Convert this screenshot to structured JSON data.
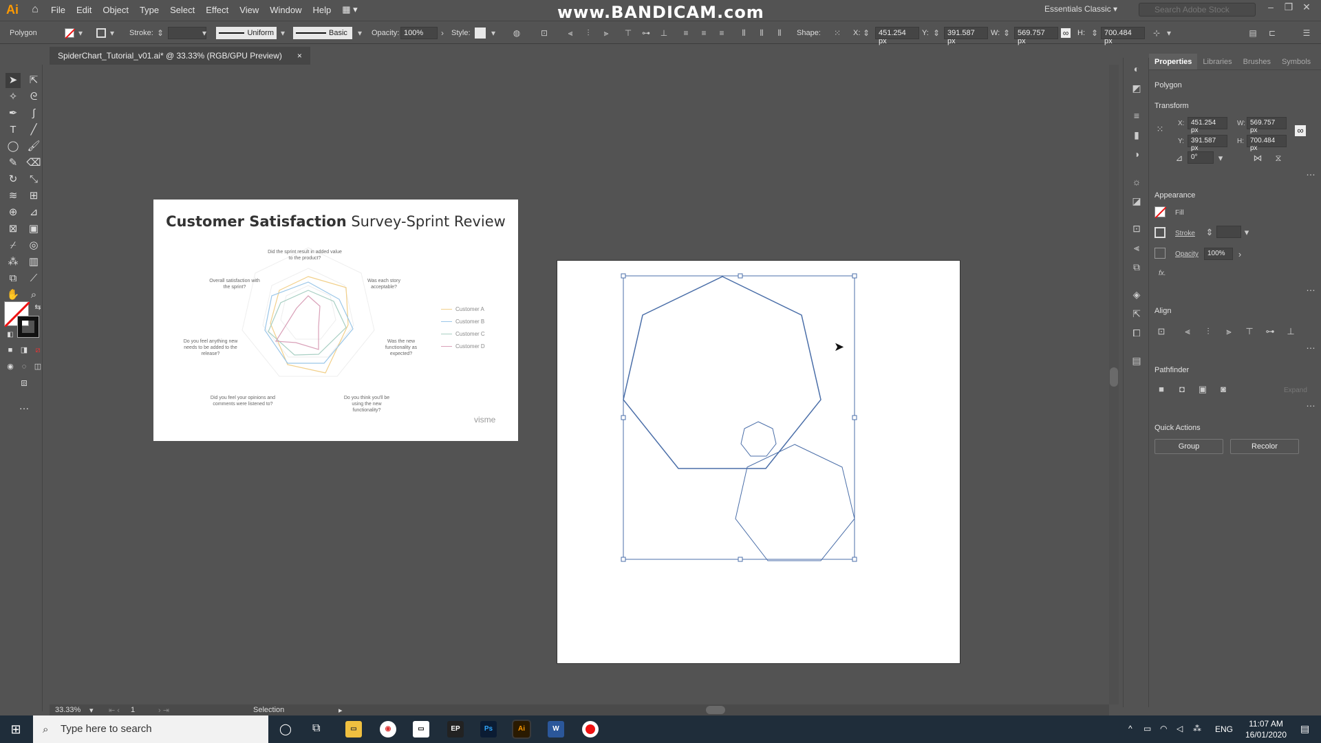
{
  "app": {
    "logo": "Ai",
    "menus": [
      "File",
      "Edit",
      "Object",
      "Type",
      "Select",
      "Effect",
      "View",
      "Window",
      "Help"
    ],
    "watermark": "www.BANDICAM.com",
    "workspace": "Essentials Classic",
    "stock_search_placeholder": "Search Adobe Stock"
  },
  "controlbar": {
    "selection": "Polygon",
    "stroke_label": "Stroke:",
    "stroke_profile": "Uniform",
    "brush": "Basic",
    "opacity_label": "Opacity:",
    "opacity_value": "100%",
    "style_label": "Style:",
    "shape_label": "Shape:",
    "x_label": "X:",
    "x_value": "451.254 px",
    "y_label": "Y:",
    "y_value": "391.587 px",
    "w_label": "W:",
    "w_value": "569.757 px",
    "h_label": "H:",
    "h_value": "700.484 px"
  },
  "document": {
    "tab_title": "SpiderChart_Tutorial_v01.ai* @ 33.33% (RGB/GPU Preview)",
    "close": "×"
  },
  "reference": {
    "title_bold": "Customer Satisfaction",
    "title_rest": " Survey-Sprint Review",
    "labels": {
      "top": "Did the sprint result in added value to the product?",
      "top_right": "Was each story acceptable?",
      "right": "Was the new functionality as expected?",
      "bottom_right": "Do you think you'll be using the new functionality?",
      "bottom_left": "Did you feel your opinions and comments were listened to?",
      "left": "Do you feel anything new needs to be added to the release?",
      "top_left": "Overall satisfaction with the sprint?"
    },
    "legend": [
      {
        "name": "Customer A",
        "color": "#f2d08a"
      },
      {
        "name": "Customer B",
        "color": "#9ac6e8"
      },
      {
        "name": "Customer C",
        "color": "#a8cfc3"
      },
      {
        "name": "Customer D",
        "color": "#d9a0b8"
      }
    ],
    "brand": "visme"
  },
  "statusbar": {
    "zoom": "33.33%",
    "page": "1",
    "tool": "Selection"
  },
  "properties": {
    "tabs": [
      "Properties",
      "Libraries",
      "Brushes",
      "Symbols"
    ],
    "object_type": "Polygon",
    "transform_title": "Transform",
    "x_label": "X:",
    "x_value": "451.254 px",
    "y_label": "Y:",
    "y_value": "391.587 px",
    "w_label": "W:",
    "w_value": "569.757 px",
    "h_label": "H:",
    "h_value": "700.484 px",
    "angle_value": "0°",
    "appearance_title": "Appearance",
    "fill_label": "Fill",
    "stroke_label": "Stroke",
    "opacity_label": "Opacity",
    "opacity_value": "100%",
    "fx_label": "fx.",
    "align_title": "Align",
    "pathfinder_title": "Pathfinder",
    "expand_label": "Expand",
    "quick_actions_title": "Quick Actions",
    "group_button": "Group",
    "recolor_button": "Recolor"
  },
  "taskbar": {
    "search_placeholder": "Type here to search",
    "language": "ENG",
    "time": "11:07 AM",
    "date": "16/01/2020",
    "apps": [
      "File Explorer",
      "Chrome",
      "Mail",
      "Epic Games",
      "Photoshop",
      "Illustrator",
      "Word",
      "Bandicam"
    ]
  },
  "colors": {
    "accent_orange": "#ff9a00",
    "selection_blue": "#4a6ea8"
  }
}
